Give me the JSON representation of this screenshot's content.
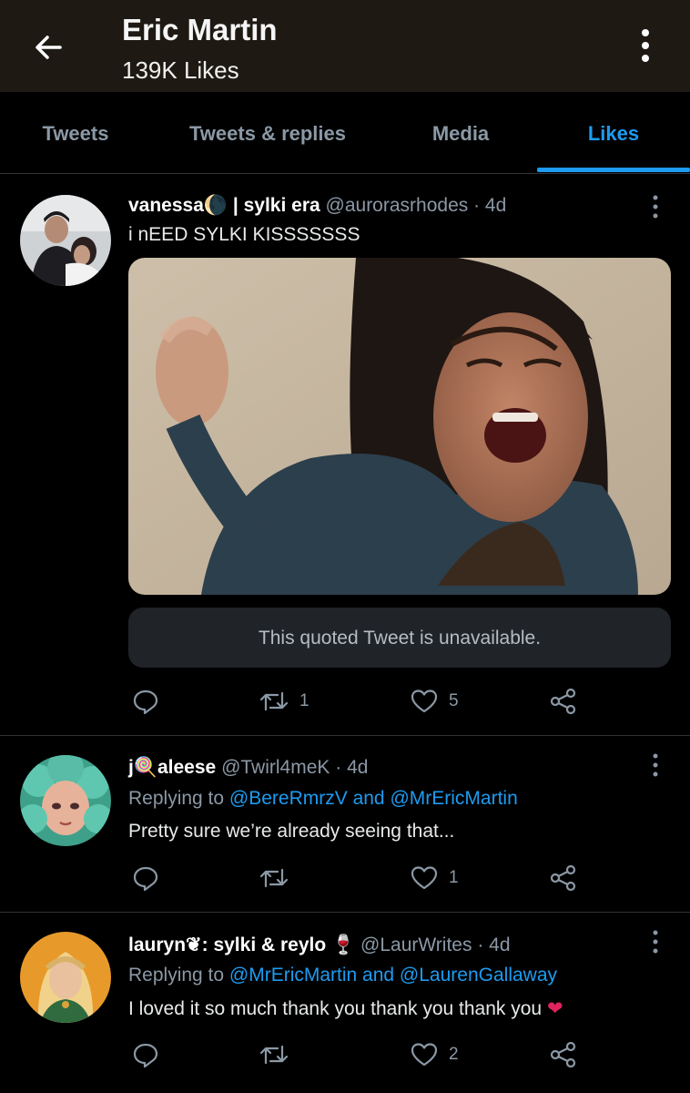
{
  "header": {
    "title": "Eric Martin",
    "subtitle": "139K Likes"
  },
  "tabs": [
    {
      "label": "Tweets"
    },
    {
      "label": "Tweets & replies"
    },
    {
      "label": "Media"
    },
    {
      "label": "Likes"
    }
  ],
  "active_tab": "Likes",
  "colors": {
    "accent": "#1d9bf0",
    "background": "#000000",
    "header_bg": "#1e1a13",
    "heart_red": "#e0245e"
  },
  "tweets": [
    {
      "name": "vanessa🌘 | sylki era",
      "handle": "@aurorasrhodes",
      "time": "· 4d",
      "text": "i nEED SYLKI KISSSSSSS",
      "quoted_notice": "This quoted Tweet is unavailable.",
      "retweets": "1",
      "likes": "5"
    },
    {
      "name": "j🍭aleese",
      "handle": "@Twirl4meK",
      "time": "· 4d",
      "replying_prefix": "Replying to",
      "replying_to": "@BereRmrzV and @MrEricMartin",
      "text": "Pretty sure we’re already seeing that...",
      "retweets": "",
      "likes": "1"
    },
    {
      "name": "lauryn❦: sylki & reylo 🍷",
      "handle": "@LaurWrites",
      "time": "· 4d",
      "replying_prefix": "Replying to",
      "replying_to": "@MrEricMartin and @LaurenGallaway",
      "text": "I loved it so much thank you thank you thank you",
      "text_emoji": "❤",
      "retweets": "",
      "likes": "2"
    }
  ],
  "icons": [
    "back-arrow-icon",
    "more-vertical-icon",
    "reply-icon",
    "retweet-icon",
    "like-icon",
    "share-icon"
  ]
}
